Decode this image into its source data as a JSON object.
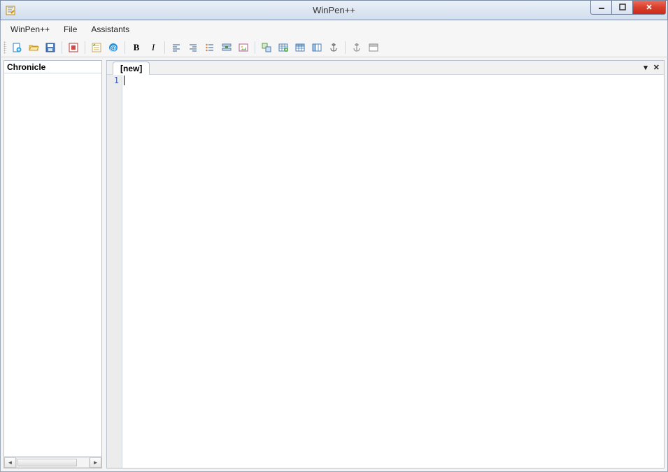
{
  "window": {
    "title": "WinPen++"
  },
  "menus": [
    {
      "label": "WinPen++"
    },
    {
      "label": "File"
    },
    {
      "label": "Assistants"
    }
  ],
  "toolbar_icons": [
    "new-file-icon",
    "open-folder-icon",
    "save-icon",
    "sep",
    "stop-icon",
    "sep",
    "checklist-icon",
    "at-icon",
    "sep",
    "bold-icon",
    "italic-icon",
    "sep",
    "align-left-icon",
    "align-right-icon",
    "list-bullet-icon",
    "insert-row-icon",
    "image-icon",
    "sep",
    "link-icon",
    "table-insert-icon",
    "table-icon",
    "columns-icon",
    "anchor-icon",
    "sep",
    "anchor-alt-icon",
    "panel-icon"
  ],
  "sidebar": {
    "title": "Chronicle"
  },
  "tabs": [
    {
      "label": "[new]"
    }
  ],
  "editor": {
    "line_number": "1"
  }
}
